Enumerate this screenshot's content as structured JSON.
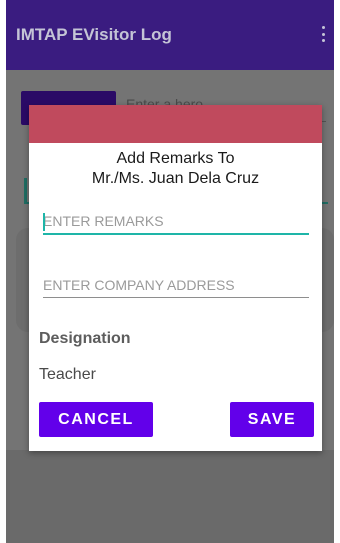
{
  "appbar": {
    "title": "IMTAP EVisitor Log"
  },
  "background": {
    "input_text": "Enter a hero"
  },
  "dialog": {
    "title_line1": "Add Remarks To",
    "title_line2": "Mr./Ms. Juan Dela Cruz",
    "remarks_placeholder": "ENTER REMARKS",
    "address_placeholder": "ENTER COMPANY ADDRESS",
    "designation_label": "Designation",
    "designation_value": "Teacher",
    "cancel_label": "CANCEL",
    "save_label": "SAVE"
  },
  "colors": {
    "appbar": "#3a1c80",
    "dialog_header": "#c04a5d",
    "button": "#6200ea",
    "focus": "#1eb5a8"
  }
}
